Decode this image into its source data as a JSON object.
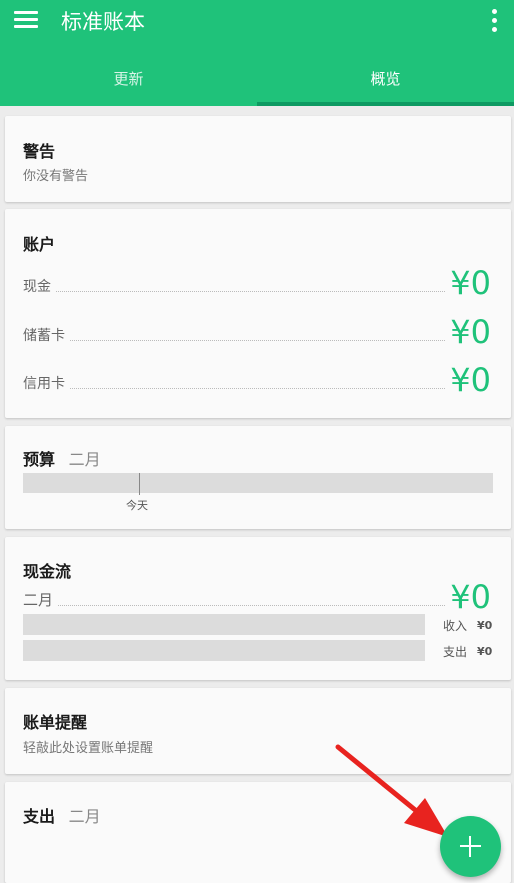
{
  "app": {
    "title": "标准账本"
  },
  "tabs": [
    {
      "label": "更新"
    },
    {
      "label": "概览"
    }
  ],
  "warnings": {
    "title": "警告",
    "subtitle": "你没有警告"
  },
  "accounts": {
    "title": "账户",
    "items": [
      {
        "label": "现金",
        "value": "¥0"
      },
      {
        "label": "储蓄卡",
        "value": "¥0"
      },
      {
        "label": "信用卡",
        "value": "¥0"
      }
    ]
  },
  "budget": {
    "title": "预算",
    "period": "二月",
    "today_label": "今天"
  },
  "cashflow": {
    "title": "现金流",
    "period": "二月",
    "total": "¥0",
    "income_label": "收入",
    "income_value": "¥0",
    "expense_label": "支出",
    "expense_value": "¥0"
  },
  "bills": {
    "title": "账单提醒",
    "subtitle": "轻敲此处设置账单提醒"
  },
  "expenses": {
    "title": "支出",
    "period": "二月"
  },
  "colors": {
    "primary": "#1fc27a",
    "tab_indicator": "#0e9a62",
    "arrow": "#e8231f"
  },
  "icons": {
    "menu": "menu-icon",
    "more": "more-vert-icon",
    "fab": "add-icon"
  }
}
